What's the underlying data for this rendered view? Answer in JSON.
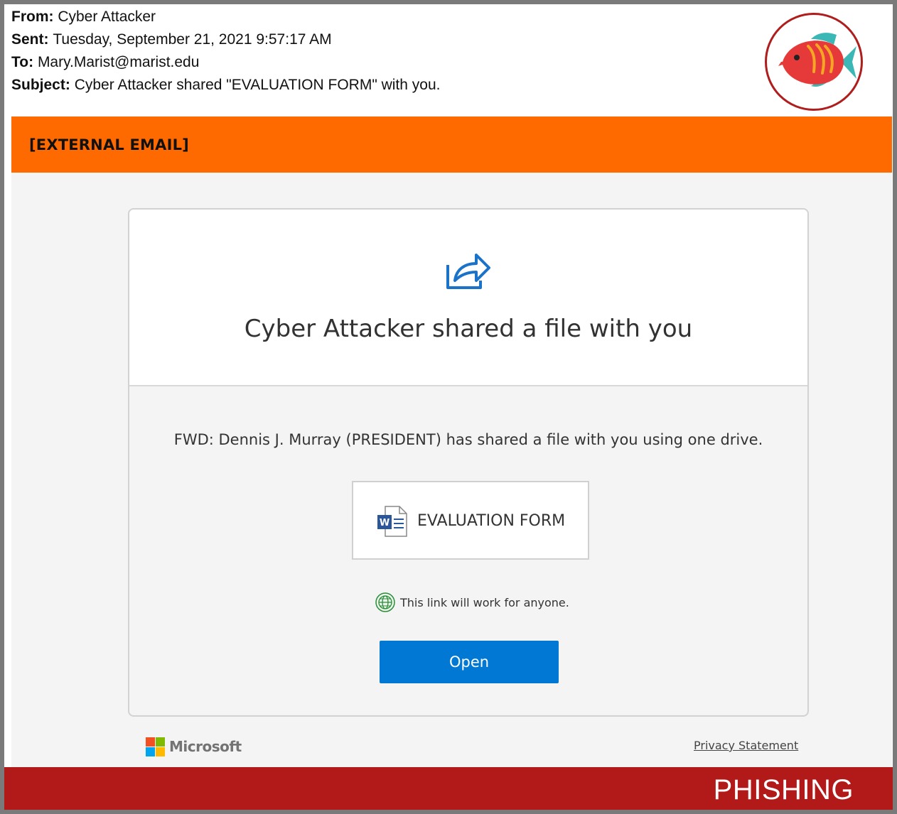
{
  "email_headers": {
    "from_label": "From:",
    "from_value": "Cyber Attacker",
    "sent_label": "Sent:",
    "sent_value": "Tuesday, September 21, 2021 9:57:17 AM",
    "to_label": "To:",
    "to_value": "Mary.Marist@marist.edu",
    "subject_label": "Subject:",
    "subject_value": "Cyber Attacker shared \"EVALUATION FORM\" with you."
  },
  "badge_icon": "fish-logo-icon",
  "external_banner": {
    "text": "[EXTERNAL EMAIL]",
    "color": "#ff6a00"
  },
  "card": {
    "icon": "share-icon",
    "title": "Cyber Attacker shared a file with you",
    "message": "FWD: Dennis J. Murray (PRESIDENT) has shared a file with you using one drive.",
    "file": {
      "icon": "word-document-icon",
      "name": "EVALUATION FORM"
    },
    "link_notice": {
      "icon": "globe-icon",
      "text": "This link will work for anyone."
    },
    "open_button": {
      "label": "Open",
      "color": "#0078d4"
    }
  },
  "footer": {
    "brand": "Microsoft",
    "privacy_link": "Privacy Statement"
  },
  "warning_bar": {
    "text": "PHISHING",
    "color": "#b21a1a"
  }
}
